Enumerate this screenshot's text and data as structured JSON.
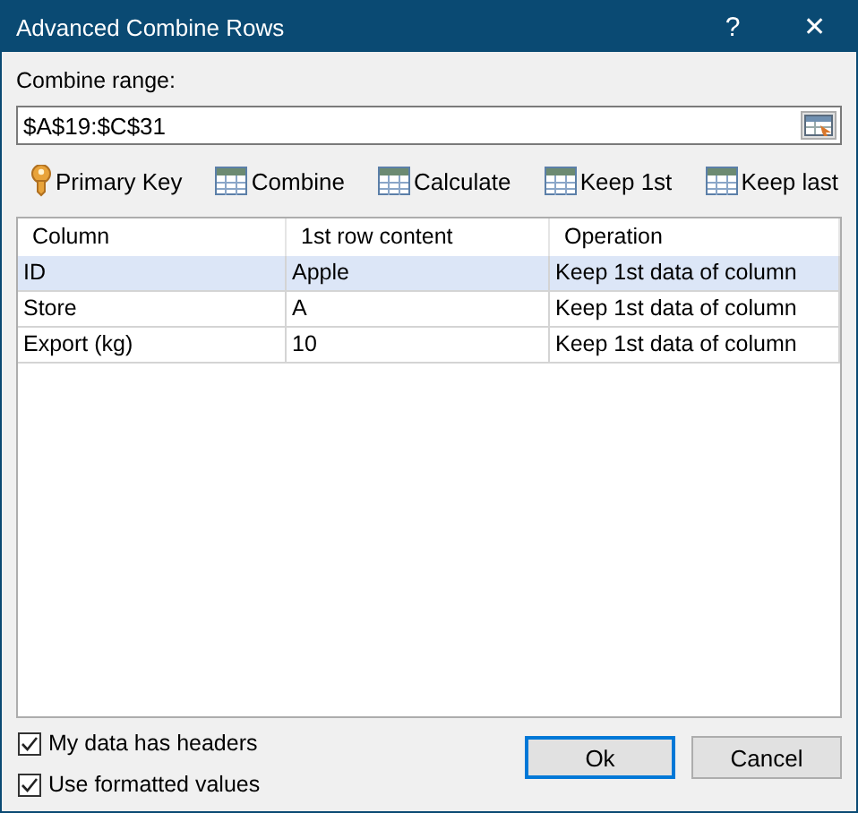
{
  "window": {
    "title": "Advanced Combine Rows",
    "help": "?",
    "close": "✕"
  },
  "range": {
    "label": "Combine range:",
    "value": "$A$19:$C$31"
  },
  "toolbar": [
    {
      "label": "Primary Key",
      "kind": "key"
    },
    {
      "label": "Combine",
      "kind": "table"
    },
    {
      "label": "Calculate",
      "kind": "table"
    },
    {
      "label": "Keep 1st",
      "kind": "table"
    },
    {
      "label": "Keep last",
      "kind": "table"
    }
  ],
  "table": {
    "columns": [
      "Column",
      "1st row content",
      "Operation"
    ],
    "rows": [
      {
        "cells": [
          "ID",
          "Apple",
          "Keep 1st data of column"
        ],
        "selected": true
      },
      {
        "cells": [
          "Store",
          "A",
          "Keep 1st data of column"
        ],
        "selected": false
      },
      {
        "cells": [
          "Export (kg)",
          "10",
          "Keep 1st data of column"
        ],
        "selected": false
      }
    ]
  },
  "options": [
    {
      "label": "My data has headers",
      "checked": true
    },
    {
      "label": "Use formatted values",
      "checked": true
    }
  ],
  "buttons": [
    {
      "label": "Ok",
      "default": true
    },
    {
      "label": "Cancel",
      "default": false
    }
  ]
}
